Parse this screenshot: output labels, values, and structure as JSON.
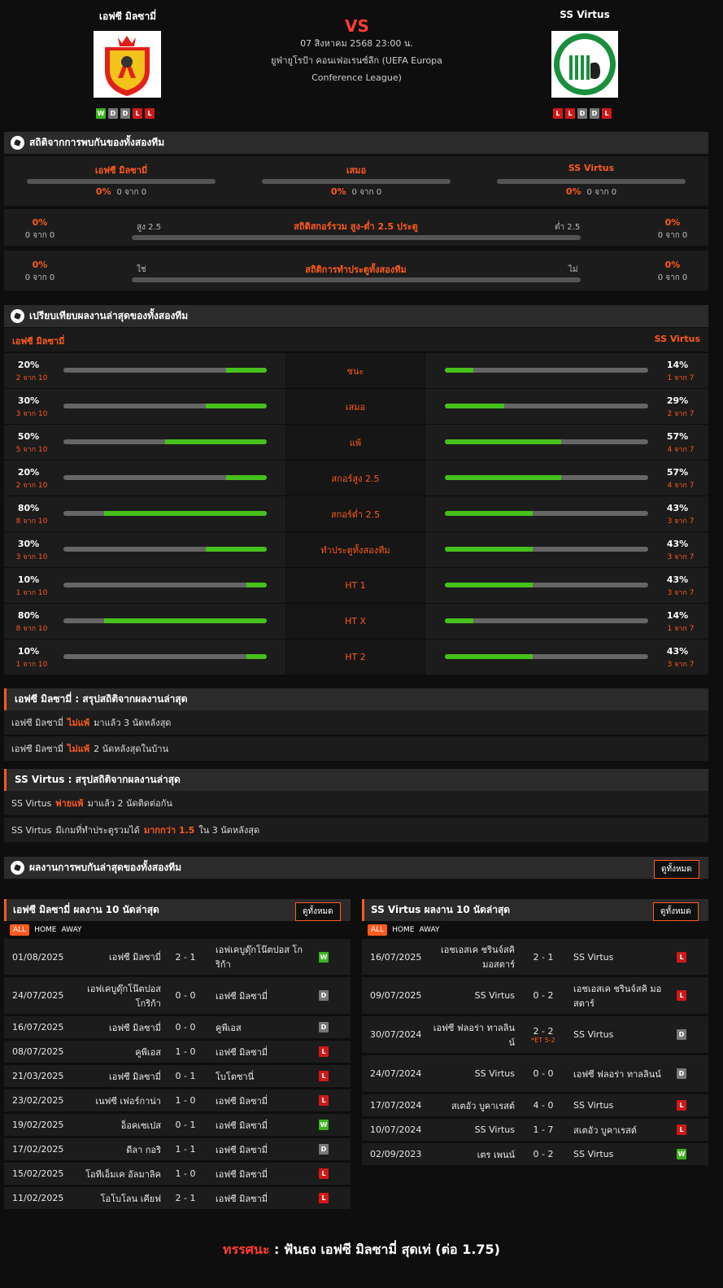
{
  "header": {
    "home_name": "เอฟซี มิลซามี่",
    "away_name": "SS Virtus",
    "vs": "VS",
    "datetime": "07 สิงหาคม 2568 23:00 น.",
    "competition_line1": "ยูฟ่ายูโรป้า คอนเฟอเรนซ์ลีก (UEFA Europa",
    "competition_line2": "Conference League)",
    "home_form": [
      "W",
      "D",
      "D",
      "L",
      "L"
    ],
    "away_form": [
      "L",
      "L",
      "D",
      "D",
      "L"
    ],
    "colors": {
      "accent": "#ff5a1f",
      "vs": "#ff3d2e",
      "win": "#3ab41f",
      "draw": "#777777",
      "loss": "#d01818",
      "bar_fill": "#46c11c"
    }
  },
  "h2h": {
    "title": "สถิติจากการพบกันของทั้งสองทีม",
    "cols": [
      {
        "label": "เอฟซี มิลซามี่",
        "pct": "0%",
        "count": "0 จาก 0"
      },
      {
        "label": "เสมอ",
        "pct": "0%",
        "count": "0 จาก 0"
      },
      {
        "label": "SS Virtus",
        "pct": "0%",
        "count": "0 จาก 0"
      }
    ],
    "ou": {
      "title": "สถิติสกอร์รวม สูง-ต่ำ 2.5 ประตู",
      "left_label": "สูง 2.5",
      "right_label": "ต่ำ 2.5",
      "left_pct": "0%",
      "left_count": "0 จาก 0",
      "right_pct": "0%",
      "right_count": "0 จาก 0"
    },
    "btts": {
      "title": "สถิติการทำประตูทั้งสองทีม",
      "left_label": "ใช่",
      "right_label": "ไม่",
      "left_pct": "0%",
      "left_count": "0 จาก 0",
      "right_pct": "0%",
      "right_count": "0 จาก 0"
    }
  },
  "compare": {
    "title": "เปรียบเทียบผลงานล่าสุดของทั้งสองทีม",
    "home": "เอฟซี มิลซามี่",
    "away": "SS Virtus",
    "rows": [
      {
        "label": "ชนะ",
        "h_pct": "20%",
        "h_sub": "2 จาก 10",
        "h_val": 0.2,
        "a_pct": "14%",
        "a_sub": "1 จาก 7",
        "a_val": 0.14
      },
      {
        "label": "เสมอ",
        "h_pct": "30%",
        "h_sub": "3 จาก 10",
        "h_val": 0.3,
        "a_pct": "29%",
        "a_sub": "2 จาก 7",
        "a_val": 0.29
      },
      {
        "label": "แพ้",
        "h_pct": "50%",
        "h_sub": "5 จาก 10",
        "h_val": 0.5,
        "a_pct": "57%",
        "a_sub": "4 จาก 7",
        "a_val": 0.57
      },
      {
        "label": "สกอร์สูง 2.5",
        "h_pct": "20%",
        "h_sub": "2 จาก 10",
        "h_val": 0.2,
        "a_pct": "57%",
        "a_sub": "4 จาก 7",
        "a_val": 0.57
      },
      {
        "label": "สกอร์ต่ำ 2.5",
        "h_pct": "80%",
        "h_sub": "8 จาก 10",
        "h_val": 0.8,
        "a_pct": "43%",
        "a_sub": "3 จาก 7",
        "a_val": 0.43
      },
      {
        "label": "ทำประตูทั้งสองทีม",
        "h_pct": "30%",
        "h_sub": "3 จาก 10",
        "h_val": 0.3,
        "a_pct": "43%",
        "a_sub": "3 จาก 7",
        "a_val": 0.43
      },
      {
        "label": "HT 1",
        "h_pct": "10%",
        "h_sub": "1 จาก 10",
        "h_val": 0.1,
        "a_pct": "43%",
        "a_sub": "3 จาก 7",
        "a_val": 0.43
      },
      {
        "label": "HT X",
        "h_pct": "80%",
        "h_sub": "8 จาก 10",
        "h_val": 0.8,
        "a_pct": "14%",
        "a_sub": "1 จาก 7",
        "a_val": 0.14
      },
      {
        "label": "HT 2",
        "h_pct": "10%",
        "h_sub": "1 จาก 10",
        "h_val": 0.1,
        "a_pct": "43%",
        "a_sub": "3 จาก 7",
        "a_val": 0.43
      }
    ]
  },
  "summary_home": {
    "title": "เอฟซี มิลซามี่ : สรุปสถิติจากผลงานล่าสุด",
    "r1": {
      "team": "เอฟซี มิลซามี่",
      "hl": "ไม่แพ้",
      "rest": "มาแล้ว 3 นัดหลังสุด"
    },
    "r2": {
      "team": "เอฟซี มิลซามี่",
      "hl": "ไม่แพ้",
      "rest": "2  นัดหลังสุดในบ้าน"
    }
  },
  "summary_away": {
    "title": "SS Virtus : สรุปสถิติจากผลงานล่าสุด",
    "r1": {
      "team": "SS Virtus",
      "hl": "พ่ายแพ้",
      "rest": "มาแล้ว 2 นัดติดต่อกัน"
    },
    "r2": {
      "team": "SS Virtus",
      "mid": "มีเกมที่ทำประตูรวมได้",
      "hl": "มากกว่า  1.5",
      "rest": "ใน 3 นัดหลังสุด"
    }
  },
  "recent": {
    "title": "ผลงานการพบกันล่าสุดของทั้งสองทีม",
    "view_all": "ดูทั้งหมด",
    "tabs": [
      "ALL",
      "HOME",
      "AWAY"
    ]
  },
  "home_results": {
    "title": "เอฟซี มิลซามี่ ผลงาน 10 นัดล่าสุด",
    "view_all": "ดูทั้งหมด",
    "rows": [
      {
        "date": "01/08/2025",
        "home": "เอฟซี มิลซามี่",
        "score": "2 - 1",
        "away": "เอฟเคบูดุ๊กโน๊ตปอส โกริก้า",
        "res": "W"
      },
      {
        "date": "24/07/2025",
        "home": "เอฟเคบูดุ๊กโน๊ตปอส โกริก้า",
        "score": "0 - 0",
        "away": "เอฟซี มิลซามี่",
        "res": "D"
      },
      {
        "date": "16/07/2025",
        "home": "เอฟซี มิลซามี่",
        "score": "0 - 0",
        "away": "คูพีเอส",
        "res": "D"
      },
      {
        "date": "08/07/2025",
        "home": "คูพีเอส",
        "score": "1 - 0",
        "away": "เอฟซี มิลซามี่",
        "res": "L"
      },
      {
        "date": "21/03/2025",
        "home": "เอฟซี มิลซามี่",
        "score": "0 - 1",
        "away": "โบโตซานี่",
        "res": "L"
      },
      {
        "date": "23/02/2025",
        "home": "เนฟซี เฟอร์กาน่า",
        "score": "1 - 0",
        "away": "เอฟซี มิลซามี่",
        "res": "L"
      },
      {
        "date": "19/02/2025",
        "home": "อ็อคเซเปส",
        "score": "0 - 1",
        "away": "เอฟซี มิลซามี่",
        "res": "W"
      },
      {
        "date": "17/02/2025",
        "home": "ดีลา กอริ",
        "score": "1 - 1",
        "away": "เอฟซี มิลซามี่",
        "res": "D"
      },
      {
        "date": "15/02/2025",
        "home": "โอทีเอ็มเค อัลมาลิค",
        "score": "1 - 0",
        "away": "เอฟซี มิลซามี่",
        "res": "L"
      },
      {
        "date": "11/02/2025",
        "home": "โอโบโลน เคียฟ",
        "score": "2 - 1",
        "away": "เอฟซี มิลซามี่",
        "res": "L"
      }
    ]
  },
  "away_results": {
    "title": "SS Virtus ผลงาน 10 นัดล่าสุด",
    "view_all": "ดูทั้งหมด",
    "rows": [
      {
        "date": "16/07/2025",
        "home": "เอชเอสเค ชรินจ์สคิ มอสตาร์",
        "score": "2 - 1",
        "away": "SS Virtus",
        "res": "L",
        "et": ""
      },
      {
        "date": "09/07/2025",
        "home": "SS Virtus",
        "score": "0 - 2",
        "away": "เอชเอสเค ชรินจ์สคิ มอสตาร์",
        "res": "L",
        "et": ""
      },
      {
        "date": "30/07/2024",
        "home": "เอฟซี ฟลอร่า ทาลลินน์",
        "score": "2 - 2",
        "away": "SS Virtus",
        "res": "D",
        "et": "*ET 5-2"
      },
      {
        "date": "24/07/2024",
        "home": "SS Virtus",
        "score": "0 - 0",
        "away": "เอฟซี ฟลอร่า ทาลลินน์",
        "res": "D",
        "et": ""
      },
      {
        "date": "17/07/2024",
        "home": "สเตอัว บูคาเรสต์",
        "score": "4 - 0",
        "away": "SS Virtus",
        "res": "L",
        "et": ""
      },
      {
        "date": "10/07/2024",
        "home": "SS Virtus",
        "score": "1 - 7",
        "away": "สเตอัว บูคาเรสต์",
        "res": "L",
        "et": ""
      },
      {
        "date": "02/09/2023",
        "home": "เตร เพนน์",
        "score": "0 - 2",
        "away": "SS Virtus",
        "res": "W",
        "et": ""
      }
    ]
  },
  "verdict": {
    "key": "ทรรศนะ",
    "sep": ":",
    "text": "ฟันธง เอฟซี มิลซามี่ สุดเท่ (ต่อ 1.75)"
  }
}
